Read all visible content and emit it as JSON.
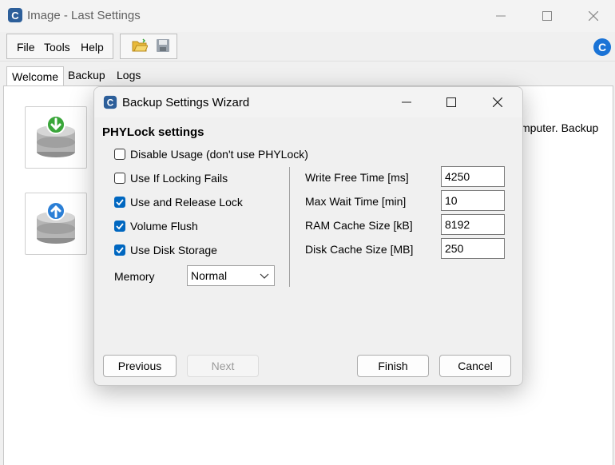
{
  "window": {
    "title": "Image - Last Settings"
  },
  "menu": {
    "file": "File",
    "tools": "Tools",
    "help": "Help"
  },
  "tabs": [
    {
      "label": "Welcome"
    },
    {
      "label": "Backup"
    },
    {
      "label": "Logs"
    }
  ],
  "background_text": "mputer. Backup",
  "dialog": {
    "title": "Backup Settings Wizard",
    "section_title": "PHYLock settings",
    "checkboxes": [
      {
        "label": "Disable Usage (don't use PHYLock)",
        "checked": false
      },
      {
        "label": "Use If Locking Fails",
        "checked": false
      },
      {
        "label": "Use and Release Lock",
        "checked": true
      },
      {
        "label": "Volume Flush",
        "checked": true
      },
      {
        "label": "Use Disk Storage",
        "checked": true
      }
    ],
    "memory": {
      "label": "Memory",
      "value": "Normal"
    },
    "fields": [
      {
        "label": "Write Free Time [ms]",
        "value": "4250"
      },
      {
        "label": "Max Wait Time [min]",
        "value": "10"
      },
      {
        "label": "RAM Cache Size [kB]",
        "value": "8192"
      },
      {
        "label": "Disk Cache Size [MB]",
        "value": "250"
      }
    ],
    "buttons": {
      "previous": "Previous",
      "next": "Next",
      "finish": "Finish",
      "cancel": "Cancel"
    }
  },
  "colors": {
    "accent": "#0067c0",
    "restore_green": "#3aa63a",
    "backup_blue": "#2b7fd6"
  }
}
